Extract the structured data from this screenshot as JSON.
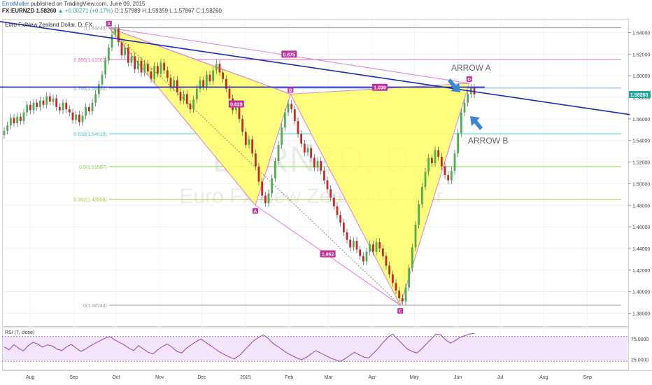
{
  "header": {
    "author": "ErrolMuller",
    "published": "published on TradingView.com, June 09, 2015",
    "symbol": "FX:EURNZD",
    "last": "1.58260",
    "change": "▲ +0.00271 (+0.17%)",
    "open_label": "O:",
    "open": "1.57989",
    "high_label": "H:",
    "high": "1.59359",
    "low_label": "L:",
    "low": "1.57867",
    "close_label": "C:",
    "close": "1.58260"
  },
  "legend": "Euro Fx/New Zealand Dollar, D, FX",
  "watermark": {
    "symbol": "EURNZD, D",
    "name": "Euro Fx/New Zealand Dollar"
  },
  "colors": {
    "pattern_fill": "#ffff66",
    "pattern_edge": "#e07bd8",
    "trendline": "#1a2bb5",
    "arrow": "#3b86d6",
    "candle_up": "#4caf50",
    "candle_down": "#c62828",
    "rsi_line": "#9b3fb5",
    "rsi_band": "#f3e5fb"
  },
  "chart_data": {
    "type": "candlestick",
    "price_axis": {
      "ylim": [
        1.368,
        1.652
      ],
      "ticks": [
        "1.64000",
        "1.62000",
        "1.60000",
        "1.58000",
        "1.56000",
        "1.54000",
        "1.52000",
        "1.50000",
        "1.48000",
        "1.46000",
        "1.44000",
        "1.42000",
        "1.40000",
        "1.38000"
      ],
      "last_price_label": "1.58260"
    },
    "time_axis": {
      "ticks": [
        "Aug",
        "Sep",
        "Oct",
        "Nov",
        "Dec",
        "2015",
        "Feb",
        "Mar",
        "Apr",
        "May",
        "Jun",
        "Jul",
        "Aug",
        "Sep"
      ]
    },
    "pattern_points": [
      {
        "label": "X",
        "date": "2014-09-26",
        "price": 1.6444
      },
      {
        "label": "A",
        "date": "2015-01-08",
        "price": 1.48
      },
      {
        "label": "B",
        "date": "2015-02-02",
        "price": 1.583
      },
      {
        "label": "C",
        "date": "2015-04-21",
        "price": 1.3874
      },
      {
        "label": "D",
        "date": "2015-06-09",
        "price": 1.593
      }
    ],
    "ratio_labels": [
      {
        "text": "0.629",
        "between": "X-A-B"
      },
      {
        "text": "0.675",
        "between": "X-B-D"
      },
      {
        "text": "1.039",
        "between": "B-D"
      },
      {
        "text": "1.862",
        "between": "A-C"
      }
    ],
    "fib_levels": [
      {
        "label": "1(1.64443)",
        "value": 1.64443,
        "color": "#999999"
      },
      {
        "label": "0.886(1.61503)",
        "value": 1.61503,
        "color": "#d070c0"
      },
      {
        "label": "0.786(1.58850)",
        "value": 1.5885,
        "color": "#7aa0e0"
      },
      {
        "label": "0.618(1.54619)",
        "value": 1.54619,
        "color": "#40c8c0"
      },
      {
        "label": "0.5(1.51587)",
        "value": 1.51587,
        "color": "#80d040"
      },
      {
        "label": "0.382(1.48556)",
        "value": 1.48556,
        "color": "#b0c040"
      },
      {
        "label": "0(1.38744)",
        "value": 1.38744,
        "color": "#999999"
      }
    ],
    "trendlines": [
      {
        "from": {
          "date": "2014-07-01",
          "price": 1.652
        },
        "to": {
          "date": "2015-10-01",
          "price": 1.564
        }
      },
      {
        "from": {
          "date": "2014-07-01",
          "price": 1.5895
        },
        "to": {
          "date": "2015-06-20",
          "price": 1.5895
        }
      }
    ],
    "annotations": [
      "ARROW A",
      "ARROW B"
    ],
    "rsi": {
      "label": "RSI (7, close)",
      "ticks": [
        "75.0000",
        "25.0000"
      ],
      "ylim": [
        0,
        100
      ],
      "overbought": 80,
      "oversold": 20
    },
    "candles": [
      1.549,
      1.554,
      1.561,
      1.556,
      1.562,
      1.558,
      1.566,
      1.573,
      1.568,
      1.575,
      1.571,
      1.577,
      1.573,
      1.581,
      1.576,
      1.579,
      1.571,
      1.568,
      1.575,
      1.569,
      1.566,
      1.559,
      1.564,
      1.557,
      1.563,
      1.571,
      1.567,
      1.575,
      1.583,
      1.592,
      1.601,
      1.614,
      1.626,
      1.638,
      1.644,
      1.631,
      1.619,
      1.626,
      1.612,
      1.618,
      1.606,
      1.614,
      1.603,
      1.611,
      1.604,
      1.597,
      1.609,
      1.602,
      1.612,
      1.605,
      1.598,
      1.589,
      1.596,
      1.585,
      1.577,
      1.583,
      1.574,
      1.569,
      1.578,
      1.588,
      1.596,
      1.59,
      1.601,
      1.595,
      1.605,
      1.611,
      1.603,
      1.597,
      1.588,
      1.579,
      1.568,
      1.572,
      1.56,
      1.548,
      1.536,
      1.541,
      1.528,
      1.516,
      1.502,
      1.489,
      1.482,
      1.491,
      1.505,
      1.521,
      1.536,
      1.552,
      1.566,
      1.574,
      1.569,
      1.558,
      1.546,
      1.537,
      1.529,
      1.533,
      1.524,
      1.515,
      1.521,
      1.512,
      1.503,
      1.495,
      1.487,
      1.479,
      1.471,
      1.464,
      1.455,
      1.448,
      1.441,
      1.447,
      1.439,
      1.433,
      1.428,
      1.437,
      1.444,
      1.437,
      1.446,
      1.44,
      1.433,
      1.424,
      1.416,
      1.408,
      1.401,
      1.394,
      1.391,
      1.404,
      1.422,
      1.441,
      1.462,
      1.481,
      1.497,
      1.511,
      1.524,
      1.519,
      1.531,
      1.525,
      1.516,
      1.508,
      1.503,
      1.512,
      1.528,
      1.547,
      1.566,
      1.575,
      1.583,
      1.589,
      1.5826
    ],
    "rsi_values": [
      55,
      48,
      60,
      52,
      45,
      58,
      66,
      62,
      54,
      60,
      57,
      50,
      46,
      55,
      61,
      52,
      44,
      50,
      58,
      64,
      70,
      76,
      80,
      72,
      66,
      60,
      52,
      46,
      58,
      50,
      42,
      38,
      48,
      56,
      62,
      54,
      44,
      40,
      52,
      60,
      68,
      74,
      66,
      58,
      50,
      42,
      36,
      30,
      26,
      34,
      46,
      58,
      70,
      78,
      84,
      76,
      64,
      56,
      48,
      40,
      34,
      28,
      24,
      30,
      38,
      46,
      40,
      34,
      28,
      24,
      20,
      26,
      34,
      42,
      36,
      30,
      28,
      40,
      52,
      66,
      78,
      86,
      74,
      62,
      50,
      44,
      40,
      50,
      62,
      74,
      86,
      84,
      72,
      64,
      70,
      78,
      82,
      86,
      88
    ]
  }
}
